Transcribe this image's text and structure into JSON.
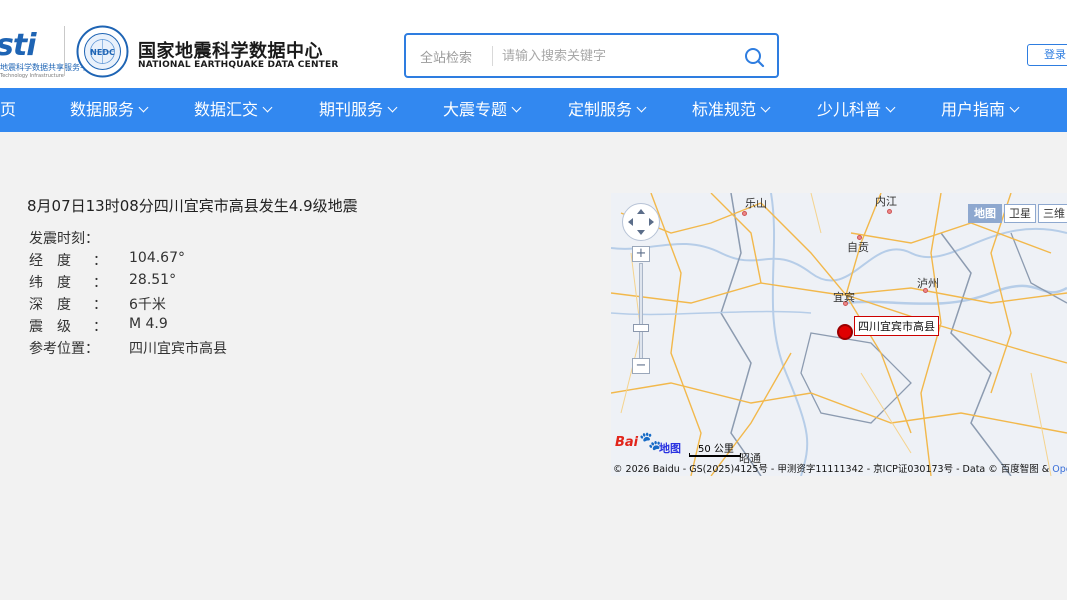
{
  "header": {
    "platform_logo_text": "sti",
    "platform_logo_sub": "地震科学数据共享服务平台",
    "platform_logo_sub2": "Technology Infrastructure",
    "org_name_cn": "国家地震科学数据中心",
    "org_name_en": "NATIONAL EARTHQUAKE DATA CENTER",
    "seal_text": "NEDC",
    "search": {
      "scope": "全站检索",
      "placeholder": "请输入搜索关键字",
      "icon": "search-icon"
    },
    "login_label": "登录"
  },
  "nav": {
    "items": [
      {
        "label": "页",
        "caret": false
      },
      {
        "label": "数据服务",
        "caret": true
      },
      {
        "label": "数据汇交",
        "caret": true
      },
      {
        "label": "期刊服务",
        "caret": true
      },
      {
        "label": "大震专题",
        "caret": true
      },
      {
        "label": "定制服务",
        "caret": true
      },
      {
        "label": "标准规范",
        "caret": true
      },
      {
        "label": "少儿科普",
        "caret": true
      },
      {
        "label": "用户指南",
        "caret": true
      }
    ]
  },
  "quake": {
    "title": "8月07日13时08分四川宜宾市高县发生4.9级地震",
    "fields": [
      {
        "label": "发震时刻：",
        "colon": "",
        "value": ""
      },
      {
        "label": "经　度",
        "colon": "：",
        "value": "104.67°"
      },
      {
        "label": "纬　度",
        "colon": "：",
        "value": "28.51°"
      },
      {
        "label": "深　度",
        "colon": "：",
        "value": "6千米"
      },
      {
        "label": "震　级",
        "colon": "：",
        "value": "M 4.9"
      },
      {
        "label": "参考位置：",
        "colon": "",
        "value": "四川宜宾市高县"
      }
    ]
  },
  "map": {
    "cities": {
      "leshan": "乐山",
      "neijiang": "内江",
      "zigong": "自贡",
      "luzhou": "泸州",
      "yibin": "宜宾",
      "zhaotong": "昭通"
    },
    "epicenter_label": "四川宜宾市高县",
    "map_types": {
      "map": "地图",
      "satellite": "卫星",
      "threed": "三维"
    },
    "zoom_in": "+",
    "zoom_out": "−",
    "baidu_text": "Bai",
    "baidu_map_text": "地图",
    "scale": "50 公里",
    "copyright": "© 2026 Baidu - GS(2025)4125号 - 甲测资字11111342 - 京ICP证030173号 - Data © 百度智图 &",
    "copyright_ost": "Ope",
    "colors": {
      "roads": "#f2b84b",
      "borders": "#8c9bb0",
      "rivers": "#b6cde8",
      "accent": "#3288f0",
      "marker": "#e00000"
    }
  }
}
